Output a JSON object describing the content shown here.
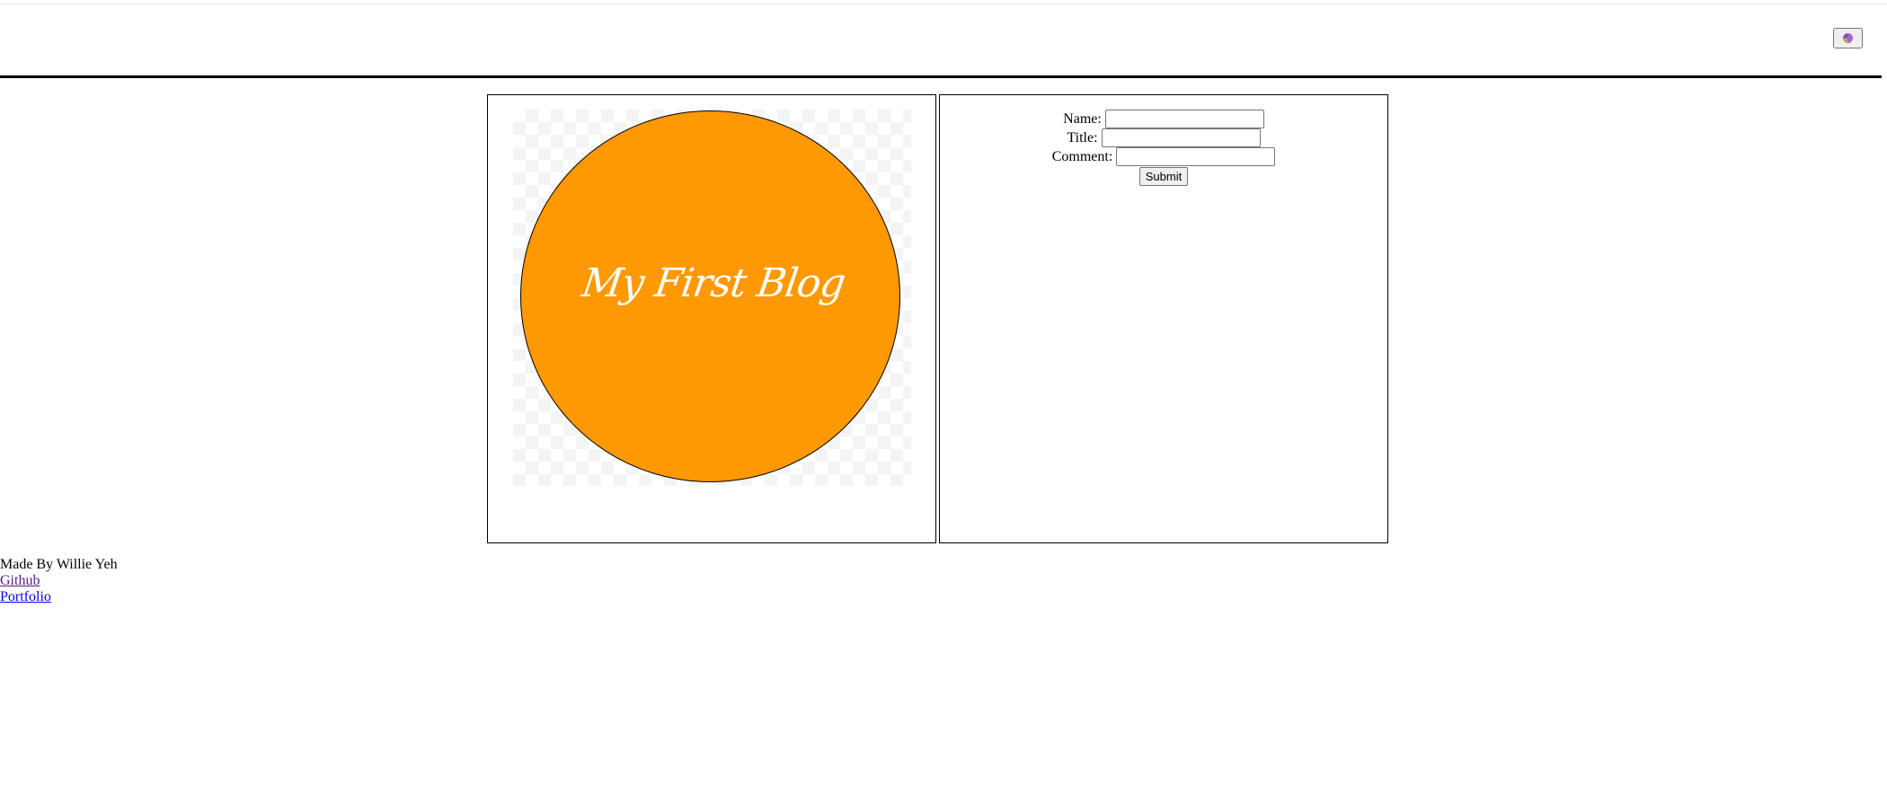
{
  "header": {
    "theme_toggle_icon": "theme-toggle-icon"
  },
  "logo": {
    "text": "My First Blog",
    "circle_color": "#fe9903",
    "text_color": "#ffffff"
  },
  "form": {
    "name_label": "Name:",
    "name_value": "",
    "title_label": "Title:",
    "title_value": "",
    "comment_label": "Comment:",
    "comment_value": "",
    "submit_label": "Submit"
  },
  "footer": {
    "credit": "Made By Willie Yeh",
    "github_label": "Github",
    "portfolio_label": "Portfolio"
  }
}
